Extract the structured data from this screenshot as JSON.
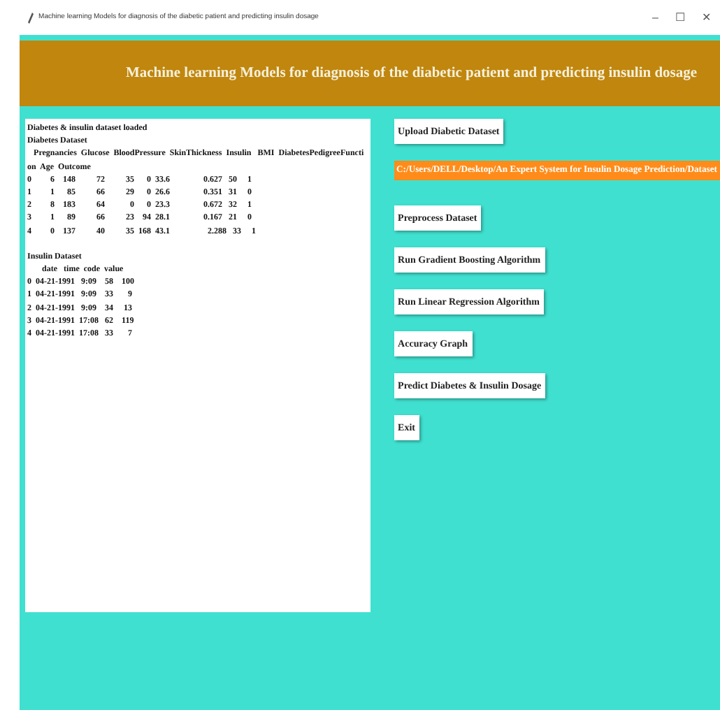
{
  "window": {
    "title": "Machine learning Models for diagnosis of the diabetic patient and predicting insulin dosage",
    "controls": [
      "–",
      "☐",
      "✕"
    ]
  },
  "header": {
    "title": "Machine learning Models for diagnosis of the diabetic patient and predicting insulin dosage"
  },
  "output": {
    "sections": [
      {
        "lines": [
          "Diabetes & insulin dataset loaded",
          "Diabetes Dataset",
          "   Pregnancies  Glucose  BloodPressure  SkinThickness  Insulin   BMI  DiabetesPedigreeFuncti",
          "on  Age  Outcome",
          "0         6    148          72          35      0  33.6                0.627   50     1",
          "1         1      85          66          29      0  26.6                0.351   31     0",
          "2         8    183          64            0      0  23.3                0.672   32     1",
          "3         1      89          66          23    94  28.1                0.167   21     0",
          "4         0    137          40          35  168  43.1                  2.288   33     1"
        ]
      },
      {
        "lines": [
          "Insulin Dataset",
          "       date   time  code  value",
          "0  04-21-1991   9:09    58    100",
          "1  04-21-1991   9:09    33       9",
          "2  04-21-1991   9:09    34     13",
          "3  04-21-1991  17:08   62    119",
          "4  04-21-1991  17:08   33       7"
        ]
      }
    ]
  },
  "actions": [
    {
      "kind": "button",
      "label": "Upload Diabetic Dataset"
    },
    {
      "kind": "path",
      "label": "C:/Users/DELL/Desktop/An Expert System for Insulin Dosage Prediction/Dataset"
    },
    {
      "kind": "button",
      "label": "Preprocess Dataset"
    },
    {
      "kind": "button",
      "label": "Run Gradient Boosting Algorithm"
    },
    {
      "kind": "button",
      "label": "Run Linear Regression Algorithm"
    },
    {
      "kind": "button",
      "label": "Accuracy Graph"
    },
    {
      "kind": "button",
      "label": "Predict Diabetes & Insulin Dosage"
    },
    {
      "kind": "button",
      "label": "Exit"
    }
  ]
}
